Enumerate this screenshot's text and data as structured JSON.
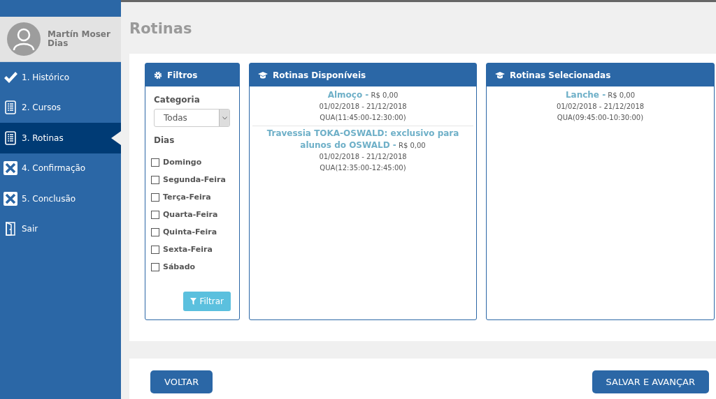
{
  "user": {
    "name": "Martín Moser Dias"
  },
  "nav": [
    {
      "label": "1. Histórico",
      "kind": "check",
      "selected": false
    },
    {
      "label": "2. Cursos",
      "kind": "list",
      "selected": false
    },
    {
      "label": "3. Rotinas",
      "kind": "list",
      "selected": true
    },
    {
      "label": "4. Confirmação",
      "kind": "x",
      "selected": false
    },
    {
      "label": "5. Conclusão",
      "kind": "x",
      "selected": false
    },
    {
      "label": "Sair",
      "kind": "door",
      "selected": false
    }
  ],
  "page_title": "Rotinas",
  "filters": {
    "title": "Filtros",
    "category_label": "Categoria",
    "category_value": "Todas",
    "days_label": "Dias",
    "days": [
      {
        "label": "Domingo",
        "checked": false
      },
      {
        "label": "Segunda-Feira",
        "checked": false
      },
      {
        "label": "Terça-Feira",
        "checked": false
      },
      {
        "label": "Quarta-Feira",
        "checked": false
      },
      {
        "label": "Quinta-Feira",
        "checked": false
      },
      {
        "label": "Sexta-Feira",
        "checked": false
      },
      {
        "label": "Sábado",
        "checked": false
      }
    ],
    "button": "Filtrar"
  },
  "available": {
    "title": "Rotinas Disponíveis",
    "items": [
      {
        "name": "Almoço -",
        "price": "R$ 0,00",
        "dates": "01/02/2018 - 21/12/2018",
        "schedule": "QUA(11:45:00-12:30:00)"
      },
      {
        "name": "Travessia TOKA-OSWALD: exclusivo para alunos do OSWALD -",
        "price": "R$ 0,00",
        "dates": "01/02/2018 - 21/12/2018",
        "schedule": "QUA(12:35:00-12:45:00)"
      }
    ]
  },
  "selected": {
    "title": "Rotinas Selecionadas",
    "items": [
      {
        "name": "Lanche -",
        "price": "R$ 0,00",
        "dates": "01/02/2018 - 21/12/2018",
        "schedule": "QUA(09:45:00-10:30:00)"
      }
    ]
  },
  "buttons": {
    "back": "VOLTAR",
    "next": "SALVAR E AVANÇAR"
  }
}
